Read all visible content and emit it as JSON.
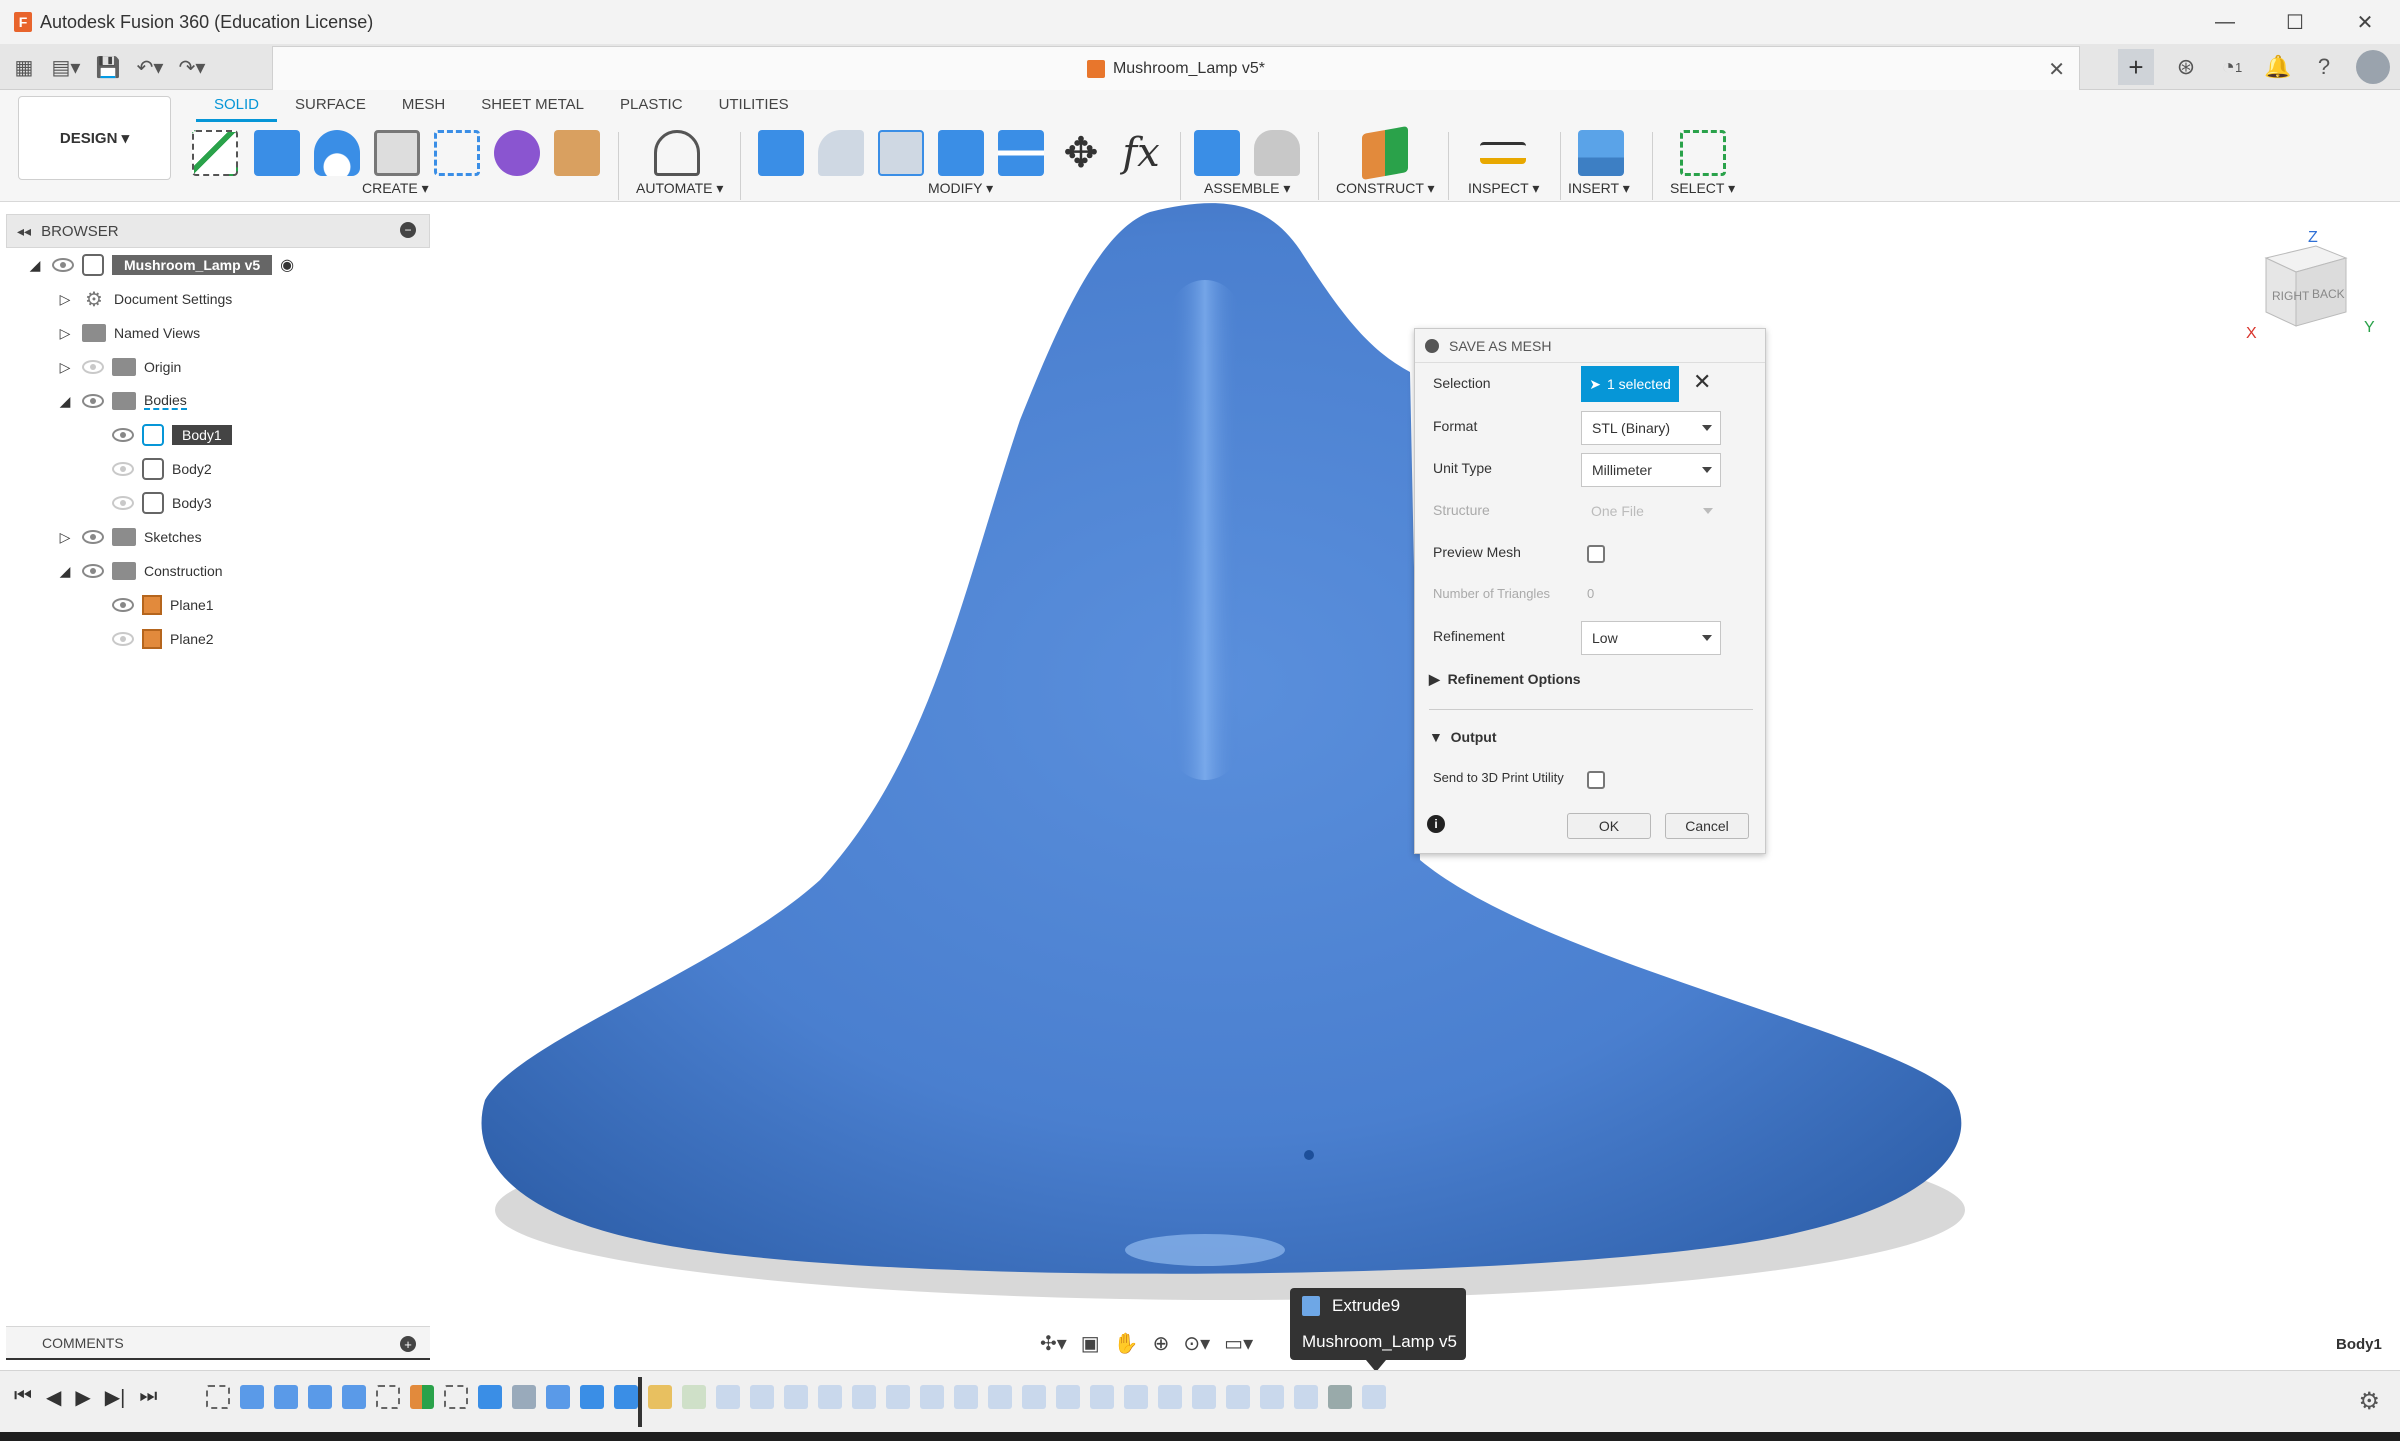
{
  "window": {
    "title": "Autodesk Fusion 360 (Education License)",
    "controls": [
      "—",
      "☐",
      "✕"
    ]
  },
  "document": {
    "tab_title": "Mushroom_Lamp v5*"
  },
  "quick_access": {
    "notifications_count": "1"
  },
  "ribbon": {
    "workspace": "DESIGN ▾",
    "tabs": [
      "SOLID",
      "SURFACE",
      "MESH",
      "SHEET METAL",
      "PLASTIC",
      "UTILITIES"
    ],
    "active_tab": "SOLID",
    "groups": {
      "create": "CREATE ▾",
      "automate": "AUTOMATE ▾",
      "modify": "MODIFY ▾",
      "assemble": "ASSEMBLE ▾",
      "construct": "CONSTRUCT ▾",
      "inspect": "INSPECT ▾",
      "insert": "INSERT ▾",
      "select": "SELECT ▾"
    }
  },
  "browser": {
    "title": "BROWSER",
    "root": "Mushroom_Lamp v5",
    "items": {
      "document_settings": "Document Settings",
      "named_views": "Named Views",
      "origin": "Origin",
      "bodies": "Bodies",
      "body1": "Body1",
      "body2": "Body2",
      "body3": "Body3",
      "sketches": "Sketches",
      "construction": "Construction",
      "plane1": "Plane1",
      "plane2": "Plane2"
    }
  },
  "viewcube": {
    "right": "RIGHT",
    "back": "BACK",
    "axis_z": "Z",
    "axis_x": "X",
    "axis_y": "Y"
  },
  "dialog": {
    "title": "SAVE AS MESH",
    "selection_label": "Selection",
    "selection_value": "1 selected",
    "format_label": "Format",
    "format_value": "STL (Binary)",
    "unit_type_label": "Unit Type",
    "unit_type_value": "Millimeter",
    "structure_label": "Structure",
    "structure_value": "One File",
    "preview_mesh_label": "Preview Mesh",
    "preview_mesh_checked": false,
    "triangles_label": "Number of Triangles",
    "triangles_value": "0",
    "refinement_label": "Refinement",
    "refinement_value": "Low",
    "refinement_options": "Refinement Options",
    "output_section": "Output",
    "send_to_3d_label": "Send to 3D Print Utility",
    "send_to_3d_checked": false,
    "ok": "OK",
    "cancel": "Cancel"
  },
  "comments": {
    "title": "COMMENTS"
  },
  "tooltip": {
    "feature": "Extrude9",
    "document": "Mushroom_Lamp v5"
  },
  "status": {
    "selected_body": "Body1"
  },
  "colors": {
    "accent": "#0696d7",
    "body_blue": "#4f86d6",
    "body_dark": "#2f5fa8"
  }
}
